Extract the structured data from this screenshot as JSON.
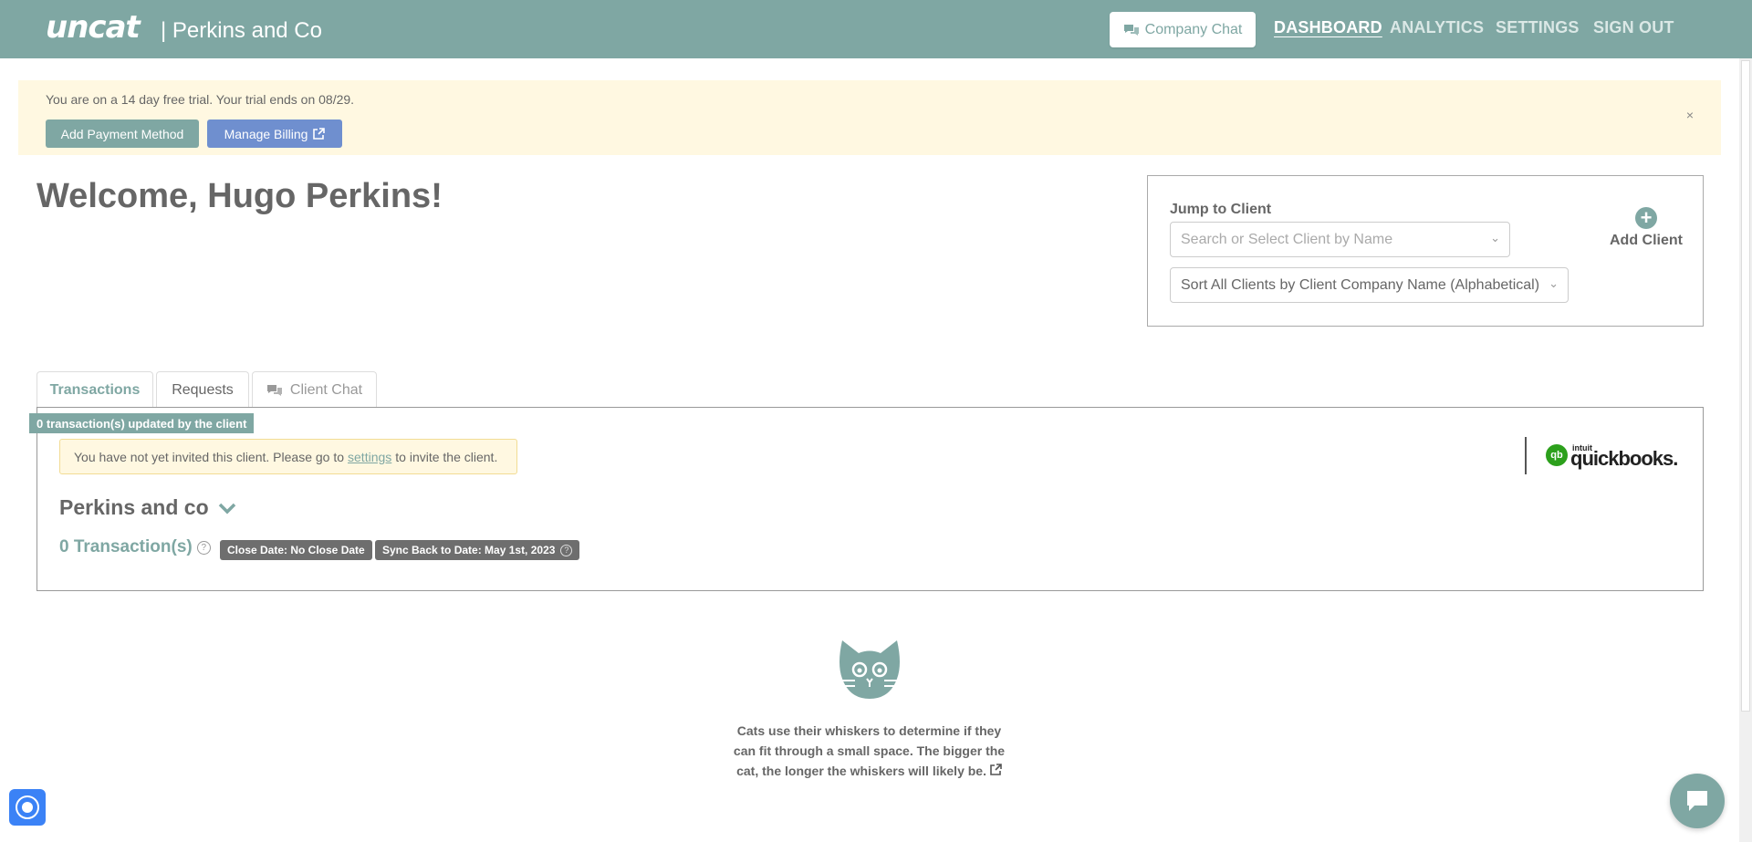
{
  "header": {
    "logo": "uncat",
    "company": "| Perkins and Co",
    "chat_button": "Company Chat",
    "nav": [
      "DASHBOARD",
      "ANALYTICS",
      "SETTINGS",
      "SIGN OUT"
    ]
  },
  "trial": {
    "text": "You are on a 14 day free trial. Your trial ends on 08/29.",
    "add_payment": "Add Payment Method",
    "manage_billing": "Manage Billing",
    "close": "×"
  },
  "welcome": "Welcome, Hugo Perkins!",
  "jump": {
    "title": "Jump to Client",
    "search_placeholder": "Search or Select Client by Name",
    "sort_value": "Sort All Clients by Client Company Name (Alphabetical)",
    "add_client": "Add Client"
  },
  "tabs": [
    "Transactions",
    "Requests",
    "Client Chat"
  ],
  "panel": {
    "updated_badge": "0 transaction(s) updated by the client",
    "invite_pre": "You have not yet invited this client. Please go to",
    "invite_link": "settings",
    "invite_post": "to invite the client.",
    "qb_intuit": "intuit",
    "qb_word": "quickbooks.",
    "client_name": "Perkins and co",
    "transactions": "0 Transaction(s)",
    "close_date": "Close Date: No Close Date",
    "sync_date": "Sync Back to Date: May 1st, 2023"
  },
  "fact": "Cats use their whiskers to determine if they can fit through a small space. The bigger the cat, the longer the whiskers will likely be.",
  "colors": {
    "brand": "#7fa7a3",
    "billing": "#6f8fcf",
    "banner": "#fff8e1"
  }
}
